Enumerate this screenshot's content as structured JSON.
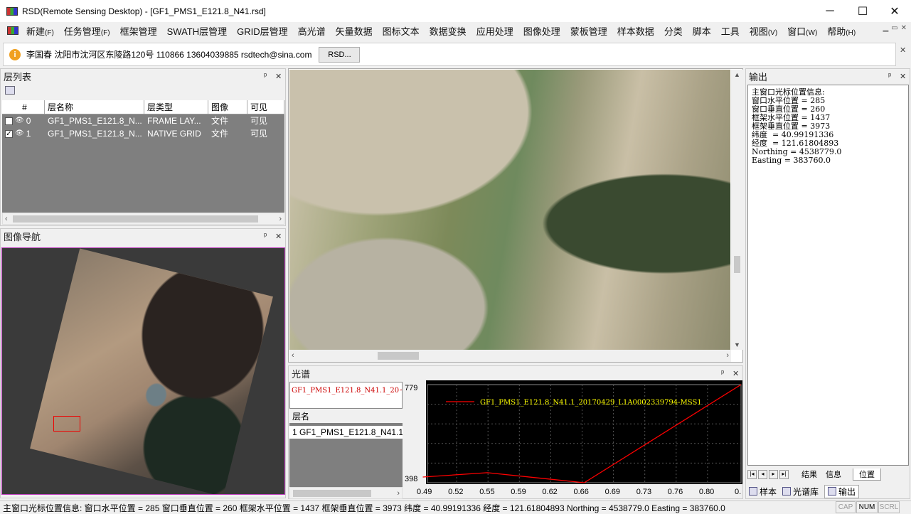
{
  "title": "RSD(Remote Sensing Desktop) - [GF1_PMS1_E121.8_N41.rsd]",
  "window_controls": {
    "minimize": "─",
    "maximize": "☐",
    "close": "✕"
  },
  "menu": [
    {
      "label": "新建",
      "key": "(F)"
    },
    {
      "label": "任务管理",
      "key": "(F)"
    },
    {
      "label": "框架管理",
      "key": ""
    },
    {
      "label": "SWATH层管理",
      "key": ""
    },
    {
      "label": "GRID层管理",
      "key": ""
    },
    {
      "label": "高光谱",
      "key": ""
    },
    {
      "label": "矢量数据",
      "key": ""
    },
    {
      "label": "图标文本",
      "key": ""
    },
    {
      "label": "数据变换",
      "key": ""
    },
    {
      "label": "应用处理",
      "key": ""
    },
    {
      "label": "图像处理",
      "key": ""
    },
    {
      "label": "蒙板管理",
      "key": ""
    },
    {
      "label": "样本数据",
      "key": ""
    },
    {
      "label": "分类",
      "key": ""
    },
    {
      "label": "脚本",
      "key": ""
    },
    {
      "label": "工具",
      "key": ""
    },
    {
      "label": "视图",
      "key": "(V)"
    },
    {
      "label": "窗口",
      "key": "(W)"
    },
    {
      "label": "帮助",
      "key": "(H)"
    }
  ],
  "infobar": {
    "text": "李国春 沈阳市沈河区东陵路120号 110866 13604039885 rsdtech@sina.com",
    "button": "RSD..."
  },
  "layer_panel": {
    "title": "层列表",
    "columns": [
      "#",
      "层名称",
      "层类型",
      "图像",
      "可见"
    ],
    "rows": [
      {
        "checked": false,
        "index": "0",
        "name": "GF1_PMS1_E121.8_N...",
        "type": "FRAME LAY...",
        "image": "文件",
        "visible": "可见"
      },
      {
        "checked": true,
        "index": "1",
        "name": "GF1_PMS1_E121.8_N...",
        "type": "NATIVE GRID",
        "image": "文件",
        "visible": "可见"
      }
    ]
  },
  "nav_panel": {
    "title": "图像导航"
  },
  "spectrum_panel": {
    "title": "光谱",
    "file_label": "GF1_PMS1_E121.8_N41.1_20~",
    "list_header": "层名",
    "list_item": "1  GF1_PMS1_E121.8_N41.1"
  },
  "chart_data": {
    "type": "line",
    "series": [
      {
        "name": "GF1_PMS1_E121.8_N41.1_20170429_L1A0002339794-MSS1",
        "x": [
          0.485,
          0.555,
          0.66,
          0.83
        ],
        "y": [
          398,
          398,
          398,
          779
        ],
        "points": [
          [
            0.485,
            420
          ],
          [
            0.555,
            437
          ],
          [
            0.66,
            398
          ],
          [
            0.83,
            779
          ]
        ]
      }
    ],
    "x_ticks": [
      "0.49",
      "0.52",
      "0.55",
      "0.59",
      "0.62",
      "0.66",
      "0.69",
      "0.73",
      "0.76",
      "0.80",
      "0."
    ],
    "y_ticks": [
      "779",
      "398"
    ],
    "ylim": [
      398,
      779
    ],
    "xlim": [
      0.49,
      0.83
    ],
    "grid": true,
    "line_color": "#ff0000",
    "legend_color": "#ffff00"
  },
  "output_panel": {
    "title": "输出",
    "lines": [
      "主窗口光标位置信息:",
      "窗口水平位置 = 285",
      "窗口垂直位置 = 260",
      "框架水平位置 = 1437",
      "框架垂直位置 = 3973",
      "纬度  = 40.99191336",
      "经度  = 121.61804893",
      "Northing = 4538779.0",
      "Easting = 383760.0"
    ],
    "tabs": [
      "结果",
      "信息",
      "位置"
    ],
    "bottom_tabs": [
      "样本",
      "光谱库",
      "输出"
    ]
  },
  "statusbar": {
    "text": "主窗口光标位置信息:   窗口水平位置 = 285 窗口垂直位置 = 260 框架水平位置 = 1437 框架垂直位置 = 3973 纬度 = 40.99191336 经度 = 121.61804893 Northing = 4538779.0 Easting = 383760.0",
    "cap": "CAP",
    "num": "NUM",
    "scrl": "SCRL"
  }
}
